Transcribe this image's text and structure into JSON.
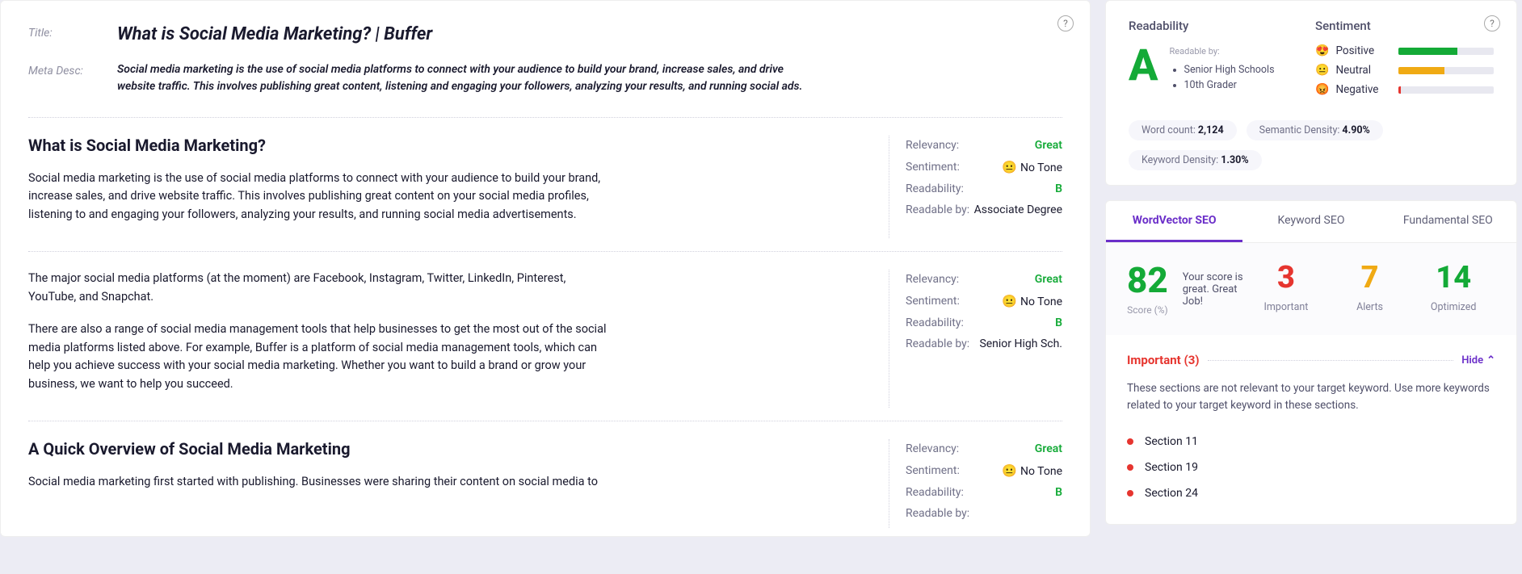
{
  "header": {
    "title_label": "Title:",
    "title": "What is Social Media Marketing? | Buffer",
    "meta_label": "Meta Desc:",
    "meta": "Social media marketing is the use of social media platforms to connect with your audience to build your brand, increase sales, and drive website traffic. This involves publishing great content, listening and engaging your followers, analyzing your results, and running social ads."
  },
  "sections": [
    {
      "heading": "What is Social Media Marketing?",
      "paras": [
        "Social media marketing is the use of social media platforms to connect with your audience to build your brand, increase sales, and drive website traffic. This involves publishing great content on your social media profiles, listening to and engaging your followers, analyzing your results, and running social media advertisements."
      ],
      "metrics": {
        "relevancy": "Great",
        "sentiment": "No Tone",
        "readability": "B",
        "readable_by": "Associate Degree"
      }
    },
    {
      "heading": "",
      "paras": [
        "The major social media platforms (at the moment) are Facebook, Instagram, Twitter, LinkedIn, Pinterest, YouTube, and Snapchat.",
        "There are also a range of social media management tools that help businesses to get the most out of the social media platforms listed above. For example, Buffer is a platform of social media management tools, which can help you achieve success with your social media marketing. Whether you want to build a brand or grow your business, we want to help you succeed."
      ],
      "metrics": {
        "relevancy": "Great",
        "sentiment": "No Tone",
        "readability": "B",
        "readable_by": "Senior High Sch."
      }
    },
    {
      "heading": "A Quick Overview of Social Media Marketing",
      "paras": [
        "Social media marketing first started with publishing. Businesses were sharing their content on social media to"
      ],
      "metrics": {
        "relevancy": "Great",
        "sentiment": "No Tone",
        "readability": "B",
        "readable_by": ""
      }
    }
  ],
  "readability": {
    "title": "Readability",
    "grade": "A",
    "readable_label": "Readable by:",
    "levels": [
      "Senior High Schools",
      "10th Grader"
    ]
  },
  "sentiment": {
    "title": "Sentiment",
    "pos_label": "Positive",
    "pos_pct": 62,
    "pos_color": "#14aa37",
    "neu_label": "Neutral",
    "neu_pct": 48,
    "neu_color": "#f0aa14",
    "neg_label": "Negative",
    "neg_pct": 2,
    "neg_color": "#e6352f"
  },
  "stats": {
    "wc_label": "Word count:",
    "wc": "2,124",
    "sd_label": "Semantic Density:",
    "sd": "4.90%",
    "kd_label": "Keyword Density:",
    "kd": "1.30%"
  },
  "tabs": [
    "WordVector SEO",
    "Keyword SEO",
    "Fundamental SEO"
  ],
  "score": {
    "value": "82",
    "msg": "Your score is great. Great Job!",
    "sub": "Score (%)",
    "important": "3",
    "important_label": "Important",
    "alerts": "7",
    "alerts_label": "Alerts",
    "optimized": "14",
    "optimized_label": "Optimized"
  },
  "important": {
    "title": "Important (3)",
    "hide": "Hide",
    "desc": "These sections are not relevant to your target keyword. Use more keywords related to your target keyword in these sections.",
    "items": [
      "Section 11",
      "Section 19",
      "Section 24"
    ]
  },
  "labels": {
    "relevancy": "Relevancy:",
    "sentiment": "Sentiment:",
    "readability": "Readability:",
    "readable_by": "Readable by:"
  }
}
